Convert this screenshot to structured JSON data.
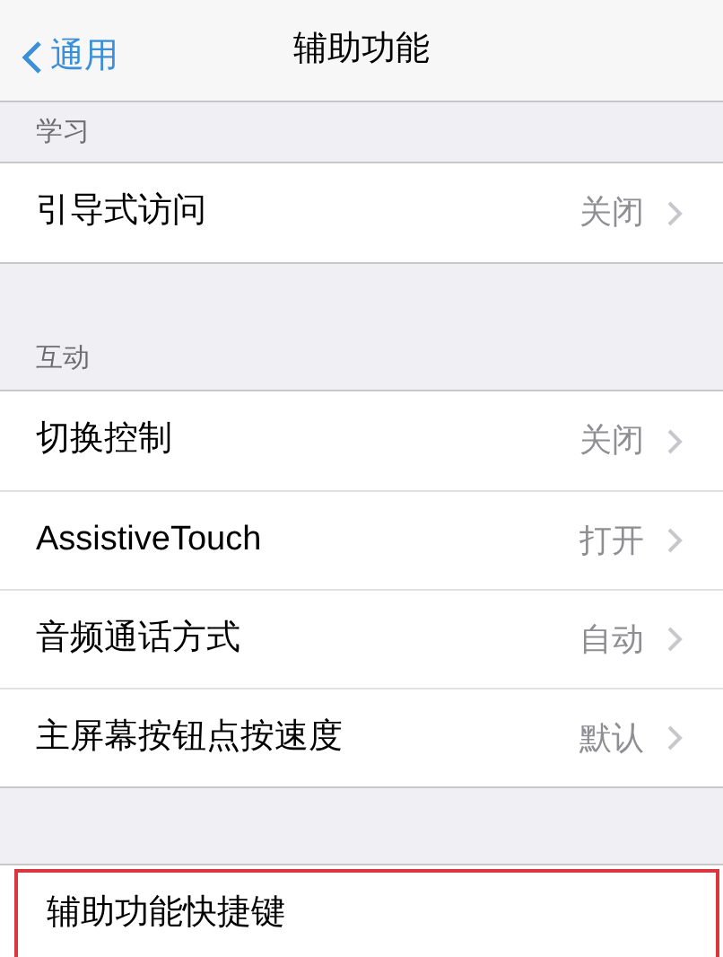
{
  "nav": {
    "back": "通用",
    "title": "辅助功能"
  },
  "sections": [
    {
      "header": "学习",
      "rows": [
        {
          "label": "引导式访问",
          "value": "关闭",
          "highlighted": false
        }
      ]
    },
    {
      "header": "互动",
      "rows": [
        {
          "label": "切换控制",
          "value": "关闭",
          "highlighted": false
        },
        {
          "label": "AssistiveTouch",
          "value": "打开",
          "highlighted": false
        },
        {
          "label": "音频通话方式",
          "value": "自动",
          "highlighted": false
        },
        {
          "label": "主屏幕按钮点按速度",
          "value": "默认",
          "highlighted": false
        }
      ]
    },
    {
      "rows": [
        {
          "label": "辅助功能快捷键",
          "highlighted": true
        }
      ]
    }
  ]
}
